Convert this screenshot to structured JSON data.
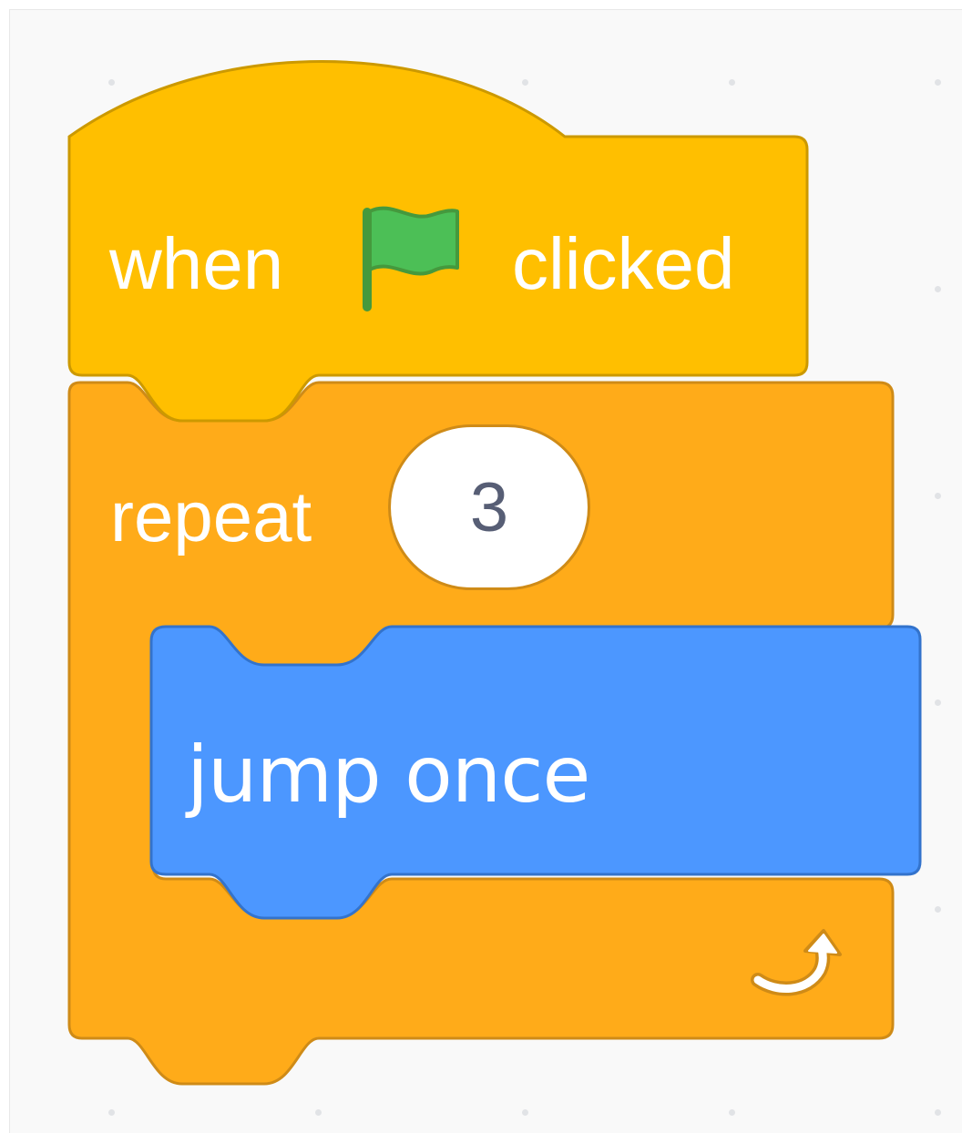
{
  "event_block": {
    "prefix": "when",
    "icon": "green-flag-icon",
    "suffix": "clicked",
    "color": "#FFBF00"
  },
  "repeat_block": {
    "label": "repeat",
    "count": "3",
    "icon": "loop-arrow-icon",
    "color": "#FFAB19"
  },
  "custom_block": {
    "label": "jump once",
    "color": "#4C97FF"
  }
}
